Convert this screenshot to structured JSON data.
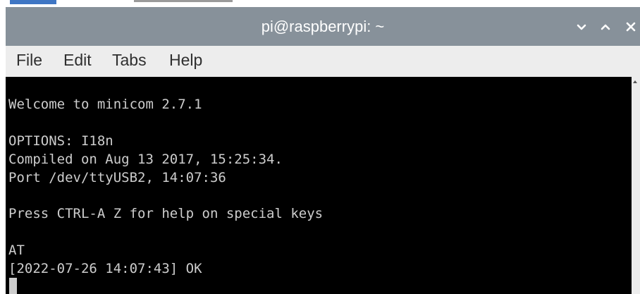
{
  "window": {
    "title": "pi@raspberrypi: ~"
  },
  "title_controls": {
    "minimize_icon": "chevron-down-icon",
    "maximize_icon": "chevron-up-icon",
    "close_icon": "close-icon"
  },
  "menu": {
    "items": [
      {
        "label": "File"
      },
      {
        "label": "Edit"
      },
      {
        "label": "Tabs"
      },
      {
        "label": "Help"
      }
    ]
  },
  "terminal": {
    "lines": [
      "Welcome to minicom 2.7.1",
      "OPTIONS: I18n",
      "Compiled on Aug 13 2017, 15:25:34.",
      "Port /dev/ttyUSB2, 14:07:36",
      "Press CTRL-A Z for help on special keys",
      "AT",
      "[2022-07-26 14:07:43] OK"
    ]
  },
  "colors": {
    "titlebar": "#87919a",
    "menubar": "#ededed",
    "terminal_bg": "#000000",
    "terminal_fg": "#cdcdcd"
  }
}
